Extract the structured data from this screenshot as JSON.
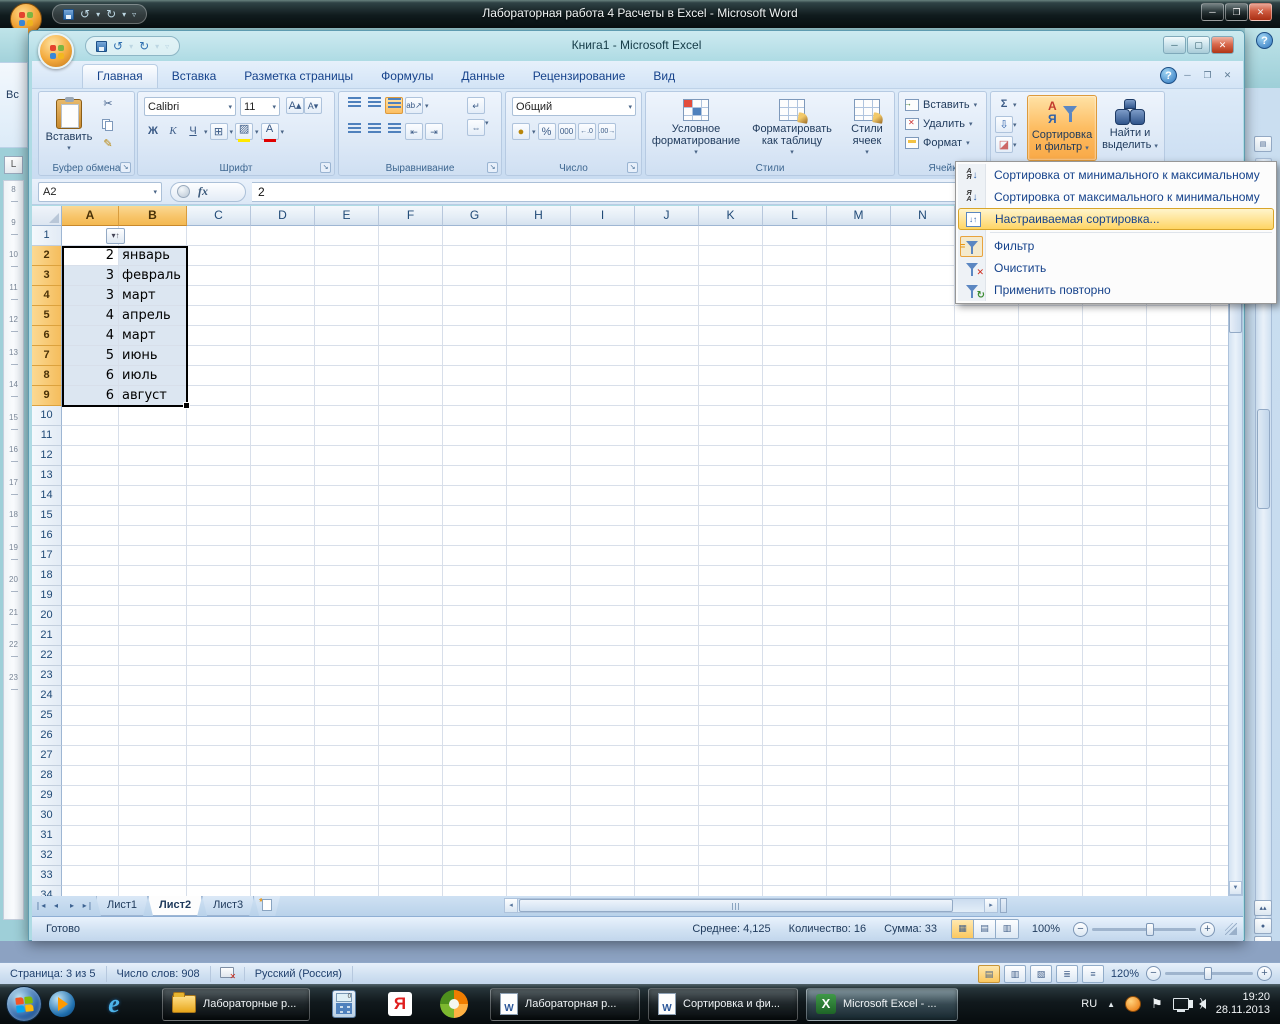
{
  "word": {
    "title": "Лабораторная работа 4 Расчеты в Excel - Microsoft Word",
    "ribbon_fragment": "Вс",
    "ruler_numbers": [
      "8",
      "9",
      "10",
      "11",
      "12",
      "13",
      "14",
      "15",
      "16",
      "17",
      "18",
      "19",
      "20",
      "21",
      "22",
      "23"
    ],
    "status": {
      "page": "Страница: 3 из 5",
      "words": "Число слов: 908",
      "language": "Русский (Россия)",
      "zoom": "120%"
    }
  },
  "excel": {
    "title": "Книга1 - Microsoft Excel",
    "tabs": [
      {
        "label": "Главная",
        "active": true
      },
      {
        "label": "Вставка"
      },
      {
        "label": "Разметка страницы"
      },
      {
        "label": "Формулы"
      },
      {
        "label": "Данные"
      },
      {
        "label": "Рецензирование"
      },
      {
        "label": "Вид"
      }
    ],
    "ribbon": {
      "clipboard": {
        "label": "Буфер обмена",
        "paste": "Вставить"
      },
      "font": {
        "label": "Шрифт",
        "name": "Calibri",
        "size": "11",
        "bold": "Ж",
        "italic": "К",
        "underline": "Ч"
      },
      "alignment": {
        "label": "Выравнивание"
      },
      "number": {
        "label": "Число",
        "format": "Общий",
        "percent": "%",
        "thousands": "000"
      },
      "styles": {
        "label": "Стили",
        "buttons": [
          "Условное форматирование",
          "Форматировать как таблицу",
          "Стили ячеек"
        ]
      },
      "cells": {
        "label": "Ячейк",
        "buttons": [
          "Вставить",
          "Удалить",
          "Формат"
        ]
      },
      "editing": {
        "sort_filter": [
          "Сортировка",
          "и фильтр"
        ],
        "find": [
          "Найти и",
          "выделить"
        ]
      }
    },
    "formula_bar": {
      "name_box": "A2",
      "value": "2"
    },
    "grid": {
      "visible_columns": [
        "A",
        "B",
        "C",
        "D",
        "E",
        "F",
        "G",
        "H",
        "I",
        "J",
        "K",
        "L",
        "M",
        "N"
      ],
      "rows": 34,
      "selection": {
        "range": "A2:B9",
        "active_cell": "A2",
        "columns": [
          "A",
          "B"
        ],
        "row_start": 2,
        "row_end": 9
      },
      "data": [
        {
          "row": 2,
          "A": "2",
          "B": "январь"
        },
        {
          "row": 3,
          "A": "3",
          "B": "февраль"
        },
        {
          "row": 4,
          "A": "3",
          "B": "март"
        },
        {
          "row": 5,
          "A": "4",
          "B": "апрель"
        },
        {
          "row": 6,
          "A": "4",
          "B": "март"
        },
        {
          "row": 7,
          "A": "5",
          "B": "июнь"
        },
        {
          "row": 8,
          "A": "6",
          "B": "июль"
        },
        {
          "row": 9,
          "A": "6",
          "B": "август"
        }
      ]
    },
    "sheet_tabs": [
      {
        "label": "Лист1"
      },
      {
        "label": "Лист2",
        "active": true
      },
      {
        "label": "Лист3"
      }
    ],
    "status": {
      "mode": "Готово",
      "average": "Среднее: 4,125",
      "count": "Количество: 16",
      "sum": "Сумма: 33",
      "zoom": "100%"
    }
  },
  "sort_menu": {
    "items": [
      {
        "icon": "sort-az-icon",
        "label": "Сортировка от минимального к максимальному"
      },
      {
        "icon": "sort-za-icon",
        "label": "Сортировка от максимального к минимальному"
      },
      {
        "icon": "custom-sort-icon",
        "label": "Настраиваемая сортировка...",
        "highlighted": true
      },
      {
        "separator": true
      },
      {
        "icon": "filter-icon",
        "label": "Фильтр",
        "icon_boxed": true
      },
      {
        "icon": "clear-filter-icon",
        "label": "Очистить"
      },
      {
        "icon": "reapply-icon",
        "label": "Применить повторно"
      }
    ]
  },
  "taskbar": {
    "windows": [
      {
        "icon": "folder-icon",
        "label": "Лабораторные р..."
      },
      {
        "icon": "word-icon",
        "label": "Лабораторная  р..."
      },
      {
        "icon": "word-icon",
        "label": "Сортировка и фи..."
      },
      {
        "icon": "excel-icon",
        "label": "Microsoft Excel - ...",
        "active": true
      }
    ],
    "tray": {
      "language": "RU",
      "time": "19:20",
      "date": "28.11.2013"
    }
  }
}
